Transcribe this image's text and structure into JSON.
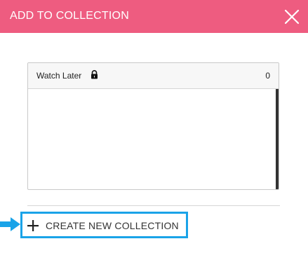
{
  "dialog": {
    "title": "ADD TO COLLECTION",
    "close_icon": "close-icon"
  },
  "collections": [
    {
      "label": "Watch Later",
      "icon": "lock-icon",
      "count": "0"
    }
  ],
  "actions": {
    "create_label": "CREATE NEW COLLECTION",
    "create_icon": "plus-icon",
    "pointer_icon": "arrow-right-icon"
  },
  "colors": {
    "header": "#ee5c80",
    "highlight": "#1aa3e8"
  }
}
